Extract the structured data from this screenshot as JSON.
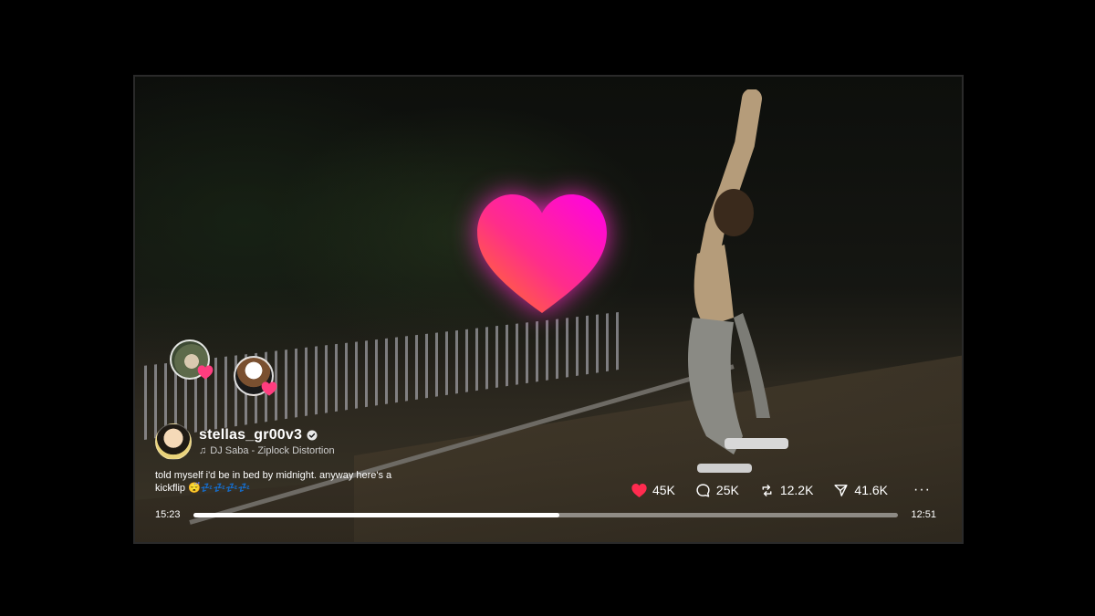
{
  "post": {
    "username": "stellas_gr00v3",
    "verified": true,
    "track": "DJ Saba - Ziplock Distortion",
    "caption": "told myself i'd be in bed by midnight. anyway here's a kickflip 😴💤💤💤💤"
  },
  "actions": {
    "likes": "45K",
    "comments": "25K",
    "reposts": "12.2K",
    "shares": "41.6K",
    "more_label": "···"
  },
  "playback": {
    "elapsed": "15:23",
    "duration": "12:51",
    "progress": 0.52
  },
  "colors": {
    "heart_gradient_start": "#ff7a1a",
    "heart_gradient_mid": "#ff2d8a",
    "heart_gradient_end": "#ff00e6",
    "like_red": "#ff2b4f"
  },
  "icons": {
    "like": "heart-icon",
    "comment": "comment-bubble-icon",
    "repost": "repost-icon",
    "share": "share-send-icon",
    "verified": "verified-badge-icon",
    "music": "music-note-icon"
  }
}
